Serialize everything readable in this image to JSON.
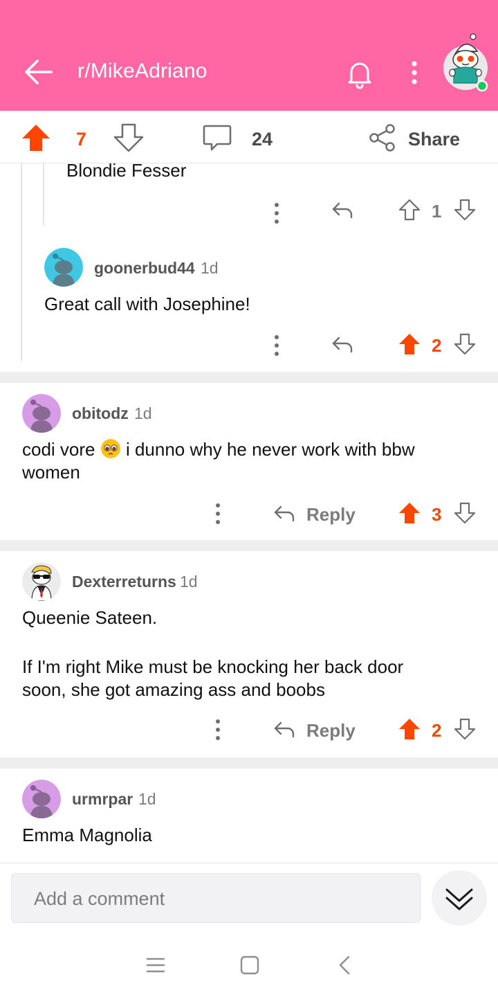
{
  "header": {
    "subreddit": "r/MikeAdriano",
    "bg_color": "#ff66a3",
    "icons": [
      "back-arrow-icon",
      "bell-icon",
      "more-vertical-icon",
      "user-avatar"
    ]
  },
  "post_bar": {
    "score": "7",
    "comment_count": "24",
    "share_label": "Share",
    "accent_color": "#ff4500"
  },
  "comments": [
    {
      "id": "c0",
      "text": "Blondie Fesser",
      "votes": "1",
      "upvoted": false
    },
    {
      "id": "c1",
      "username": "goonerbud44",
      "age": "1d",
      "text": "Great call with Josephine!",
      "votes": "2",
      "upvoted": true
    },
    {
      "id": "c2",
      "username": "obitodz",
      "age": "1d",
      "text_before_emoji": "codi vore ",
      "emoji": "pleading-face",
      "text_after_emoji": " i dunno why he never work with bbw",
      "text_line2": "women",
      "reply_label": "Reply",
      "votes": "3",
      "upvoted": true
    },
    {
      "id": "c3",
      "username": "Dexterreturns",
      "age": "1d",
      "text_line1": "Queenie Sateen.",
      "text_line2": "If I'm right Mike must be knocking her back door",
      "text_line3": "soon, she got amazing ass and boobs",
      "reply_label": "Reply",
      "votes": "2",
      "upvoted": true
    },
    {
      "id": "c4",
      "username": "urmrpar",
      "age": "1d",
      "text": "Emma Magnolia"
    }
  ],
  "comment_bar": {
    "placeholder": "Add a comment"
  },
  "system_nav": [
    "menu-icon",
    "home-square-icon",
    "back-chevron-icon"
  ]
}
